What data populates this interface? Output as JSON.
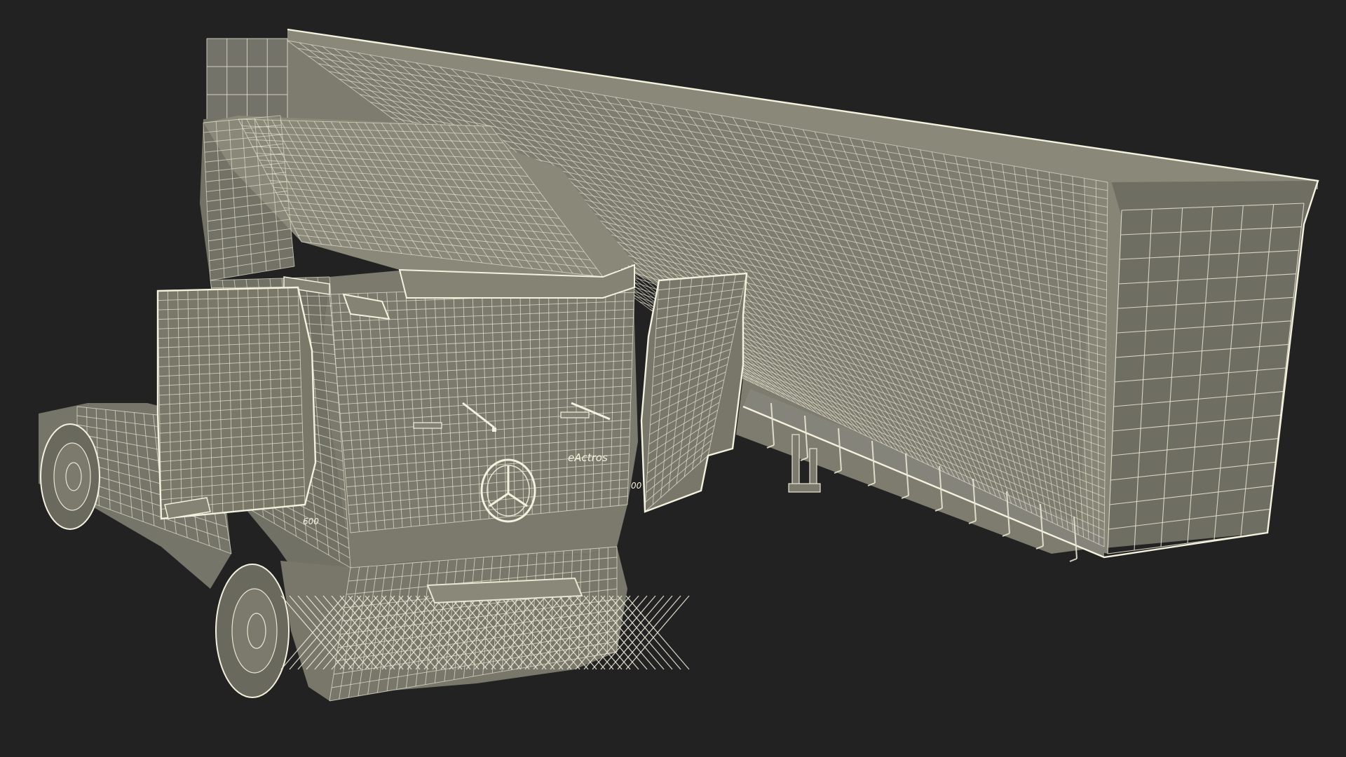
{
  "render": {
    "background": "#222222",
    "surface": "#7b7a6c",
    "surface_dark": "#6c6b5e",
    "surface_light": "#8a8979",
    "wire": "#e9e6d3"
  },
  "labels": {
    "model_badge": "eActros",
    "cab_number_left": "600",
    "cab_number_right": "00"
  }
}
